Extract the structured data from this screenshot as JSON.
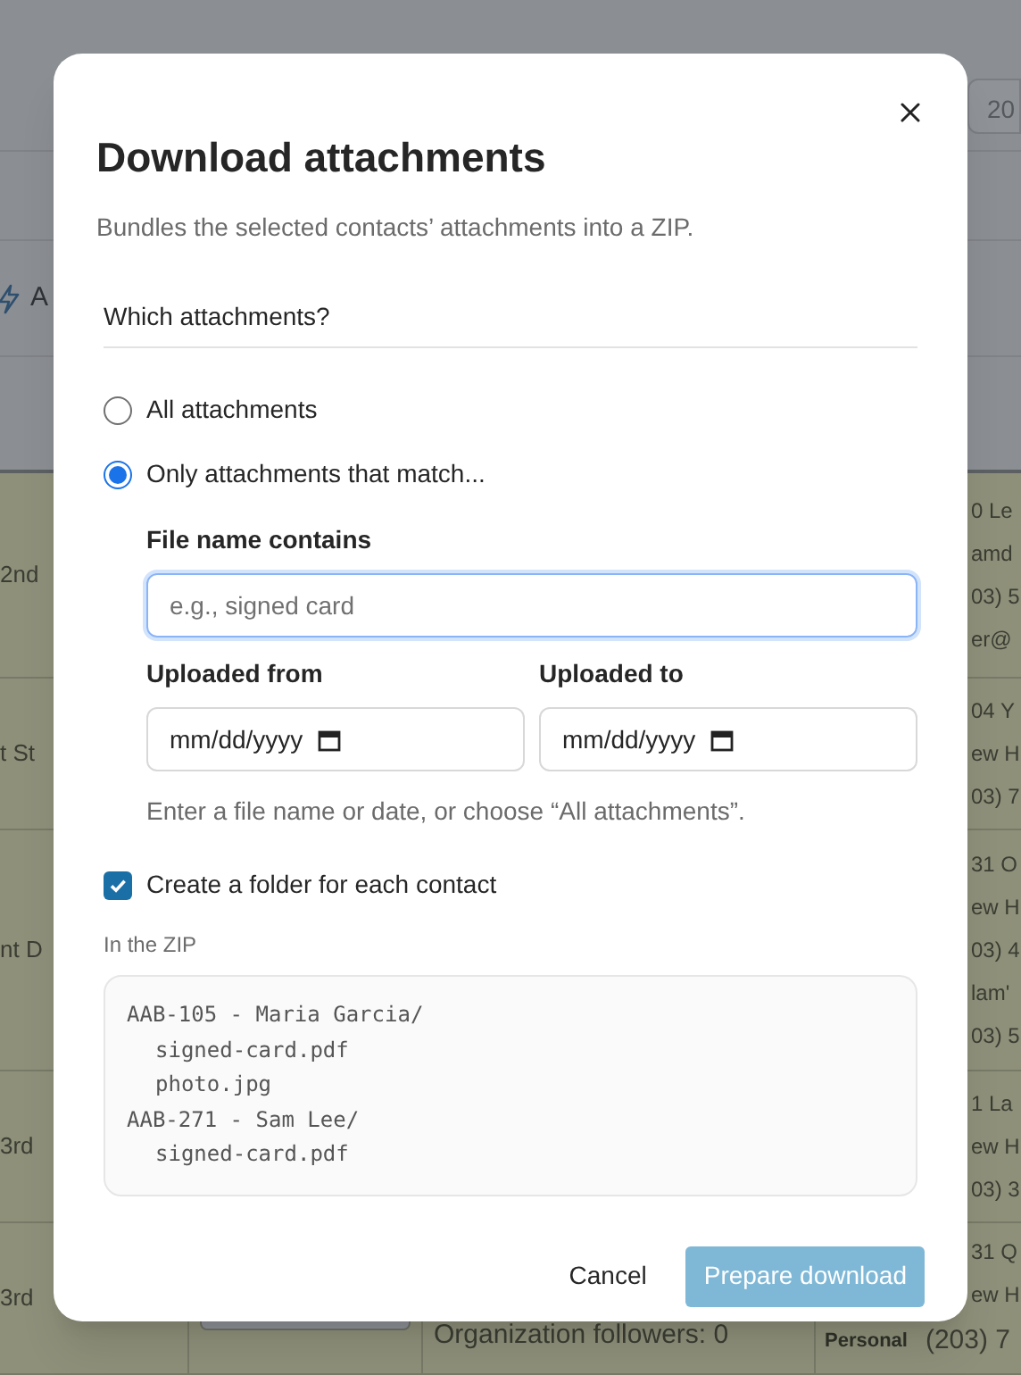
{
  "background": {
    "header_value": "20",
    "toolbar_label": "A",
    "rows": [
      {
        "column_1": "2nd",
        "column_4": [
          "0 Le",
          "amd",
          "03) 5",
          "er@"
        ]
      },
      {
        "column_1": "t St",
        "column_4": [
          "04 Y",
          "ew H",
          "03) 7"
        ]
      },
      {
        "column_1": "nt D",
        "column_4": [
          "31 O",
          "ew H",
          "03) 4",
          "lam'",
          "03) 5"
        ]
      },
      {
        "column_1": "3rd",
        "column_4": [
          "1 La",
          "ew H",
          "03) 3"
        ]
      },
      {
        "column_1": "3rd",
        "column_3": "Organization followers: 0",
        "column_4": [
          "31 Q",
          "ew H"
        ],
        "tag": "Personal",
        "phone": "(203) 7"
      }
    ]
  },
  "dialog": {
    "title": "Download attachments",
    "subtitle": "Bundles the selected contacts’ attachments into a ZIP.",
    "section": "Which attachments?",
    "options": [
      {
        "label": "All attachments",
        "selected": false
      },
      {
        "label": "Only attachments that match...",
        "selected": true
      }
    ],
    "file_name": {
      "label": "File name contains",
      "placeholder": "e.g., signed card",
      "focused": true
    },
    "dates": [
      {
        "label": "Uploaded from",
        "placeholder": "mm/dd/yyyy"
      },
      {
        "label": "Uploaded to",
        "placeholder": "mm/dd/yyyy"
      }
    ],
    "hint": "Enter a file name or date, or choose “All attachments”.",
    "folder_option": {
      "label": "Create a folder for each contact",
      "checked": true
    },
    "preview_label": "In the ZIP",
    "preview_lines": [
      {
        "text": "AAB-105 - Maria Garcia/",
        "kind": "folder"
      },
      {
        "text": "signed-card.pdf",
        "kind": "file"
      },
      {
        "text": "photo.jpg",
        "kind": "file"
      },
      {
        "text": "AAB-271 - Sam Lee/",
        "kind": "folder"
      },
      {
        "text": "signed-card.pdf",
        "kind": "file"
      }
    ],
    "buttons": [
      {
        "label": "Cancel",
        "kind": "secondary"
      },
      {
        "label": "Prepare download",
        "kind": "primary",
        "disabled": true
      }
    ]
  }
}
